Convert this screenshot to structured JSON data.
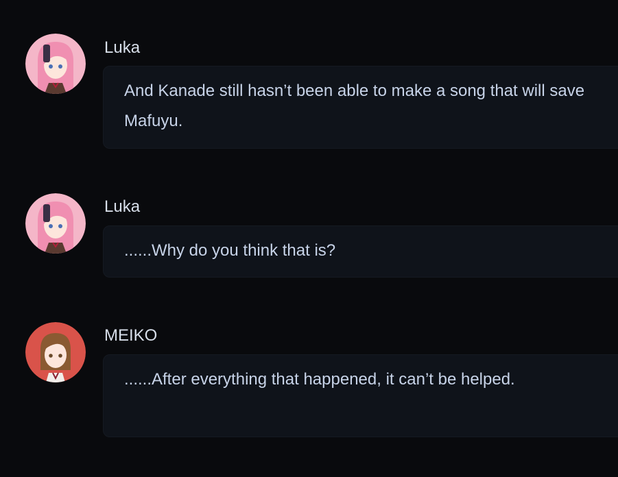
{
  "messages": [
    {
      "speaker": "Luka",
      "avatar_icon": "luka-avatar-icon",
      "text": "And Kanade still hasn’t been able to make a song that will save Mafuyu."
    },
    {
      "speaker": "Luka",
      "avatar_icon": "luka-avatar-icon",
      "text": "......Why do you think that is?"
    },
    {
      "speaker": "MEIKO",
      "avatar_icon": "meiko-avatar-icon",
      "text": "......After everything that happened, it can’t be helped."
    }
  ],
  "colors": {
    "background": "#090a0d",
    "bubble": "#0f131a",
    "text": "#c7d3e8",
    "luka_avatar_bg": "#f4b6c8",
    "meiko_avatar_bg": "#d9534a"
  }
}
